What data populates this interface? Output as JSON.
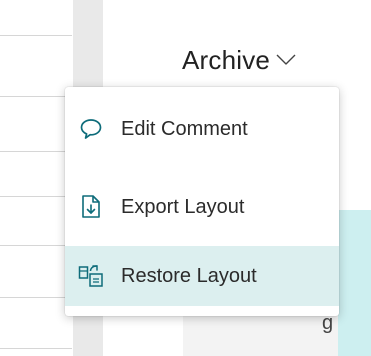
{
  "header": {
    "title": "Archive",
    "chevron_icon": "chevron-down-icon"
  },
  "menu": {
    "items": [
      {
        "label": "Edit Comment",
        "icon": "comment-icon",
        "selected": false
      },
      {
        "label": "Export Layout",
        "icon": "export-icon",
        "selected": false
      },
      {
        "label": "Restore Layout",
        "icon": "restore-layout-icon",
        "selected": true
      }
    ]
  },
  "content": {
    "peek_text": "g"
  },
  "colors": {
    "accent": "#0e6c7a",
    "selected_background": "#dcefef",
    "divider": "#e9e9e9"
  }
}
